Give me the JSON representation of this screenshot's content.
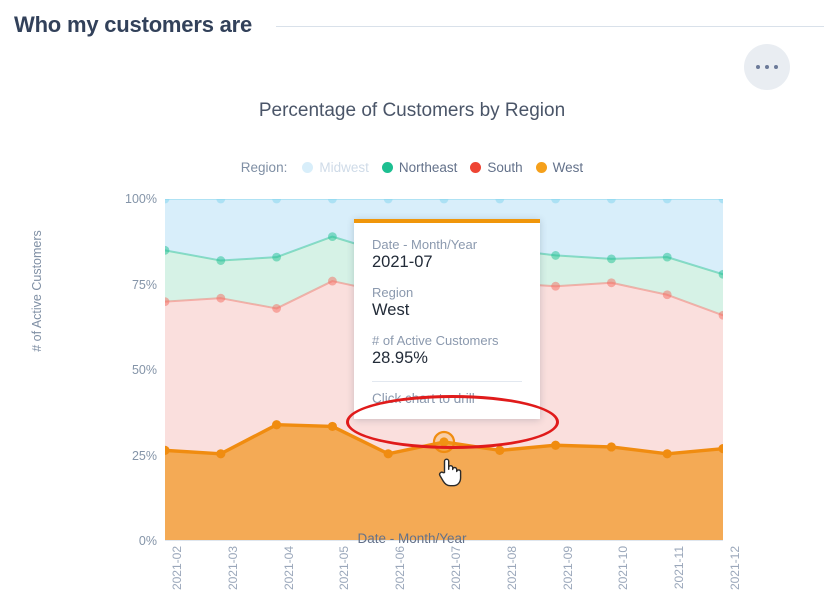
{
  "header": {
    "title": "Who my customers are",
    "overflow_menu_label": "..."
  },
  "chart_card": {
    "title": "Percentage of Customers by Region"
  },
  "tooltip": {
    "date_key": "Date - Month/Year",
    "date_value": "2021-07",
    "region_key": "Region",
    "region_value": "West",
    "metric_key": "# of Active Customers",
    "metric_value": "28.95%",
    "drill_hint": "Click chart to drill"
  },
  "chart_data": {
    "type": "area",
    "stacked": true,
    "title": "Percentage of Customers by Region",
    "xlabel": "Date - Month/Year",
    "ylabel": "# of Active Customers",
    "grid": true,
    "legend_position": "top-center",
    "legend_title": "Region:",
    "ylim": [
      0,
      100
    ],
    "yticks": [
      "0%",
      "25%",
      "50%",
      "75%",
      "100%"
    ],
    "ytick_values": [
      0,
      25,
      50,
      75,
      100
    ],
    "categories": [
      "2021-02",
      "2021-03",
      "2021-04",
      "2021-05",
      "2021-06",
      "2021-07",
      "2021-08",
      "2021-09",
      "2021-10",
      "2021-11",
      "2021-12"
    ],
    "series": [
      {
        "name": "West",
        "color": "#f08c10",
        "fill": "#f4aa55",
        "values": [
          26.5,
          25.5,
          34.0,
          33.5,
          25.5,
          28.95,
          26.5,
          28.0,
          27.5,
          25.5,
          27.0
        ]
      },
      {
        "name": "South",
        "color": "#f46b5f",
        "fill": "#fadfdd",
        "cumulative": [
          70.0,
          71.0,
          68.0,
          76.0,
          72.5,
          74.0,
          75.5,
          74.5,
          75.5,
          72.0,
          66.0
        ]
      },
      {
        "name": "Northeast",
        "color": "#1dbf91",
        "fill": "#d6f2e6",
        "cumulative": [
          85.0,
          82.0,
          83.0,
          89.0,
          84.0,
          84.0,
          85.5,
          83.5,
          82.5,
          83.0,
          78.0
        ]
      },
      {
        "name": "Midwest",
        "color": "#7fd3ee",
        "fill": "#d8eefa",
        "cumulative": [
          100,
          100,
          100,
          100,
          100,
          100,
          100,
          100,
          100,
          100,
          100
        ]
      }
    ],
    "highlight_point": {
      "category": "2021-07",
      "series": "West",
      "value": 28.95
    }
  }
}
